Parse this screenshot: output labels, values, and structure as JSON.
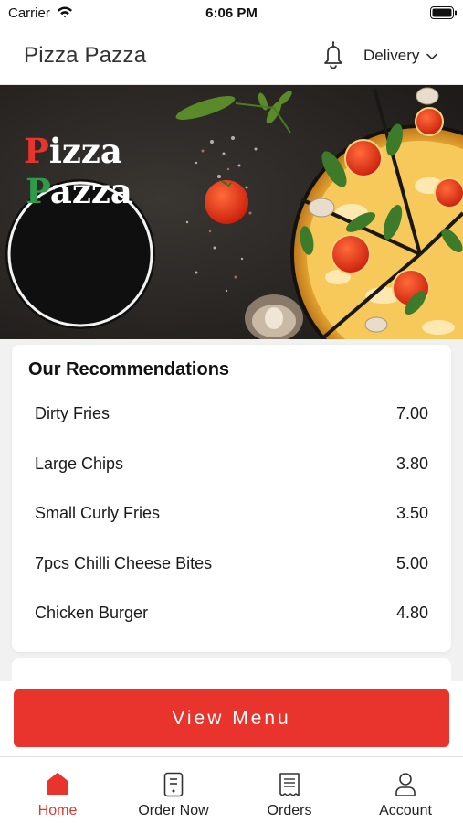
{
  "status_bar": {
    "carrier": "Carrier",
    "time": "6:06 PM"
  },
  "header": {
    "title": "Pizza Pazza",
    "delivery_mode": "Delivery"
  },
  "hero": {
    "logo_line1_initial": "P",
    "logo_line1_rest": "izza",
    "logo_line2_initial": "P",
    "logo_line2_rest": "azza"
  },
  "recommendations": {
    "title": "Our Recommendations",
    "items": [
      {
        "name": "Dirty Fries",
        "price": "7.00"
      },
      {
        "name": "Large Chips",
        "price": "3.80"
      },
      {
        "name": "Small Curly Fries",
        "price": "3.50"
      },
      {
        "name": "7pcs Chilli Cheese Bites",
        "price": "5.00"
      },
      {
        "name": "Chicken Burger",
        "price": "4.80"
      }
    ]
  },
  "cta": {
    "view_menu_label": "View Menu"
  },
  "tabs": [
    {
      "label": "Home",
      "icon": "home-icon",
      "active": true
    },
    {
      "label": "Order Now",
      "icon": "order-icon",
      "active": false
    },
    {
      "label": "Orders",
      "icon": "receipt-icon",
      "active": false
    },
    {
      "label": "Account",
      "icon": "user-icon",
      "active": false
    }
  ],
  "colors": {
    "accent": "#e8342c",
    "logo_green": "#2e9b48",
    "logo_bg": "#111111"
  }
}
